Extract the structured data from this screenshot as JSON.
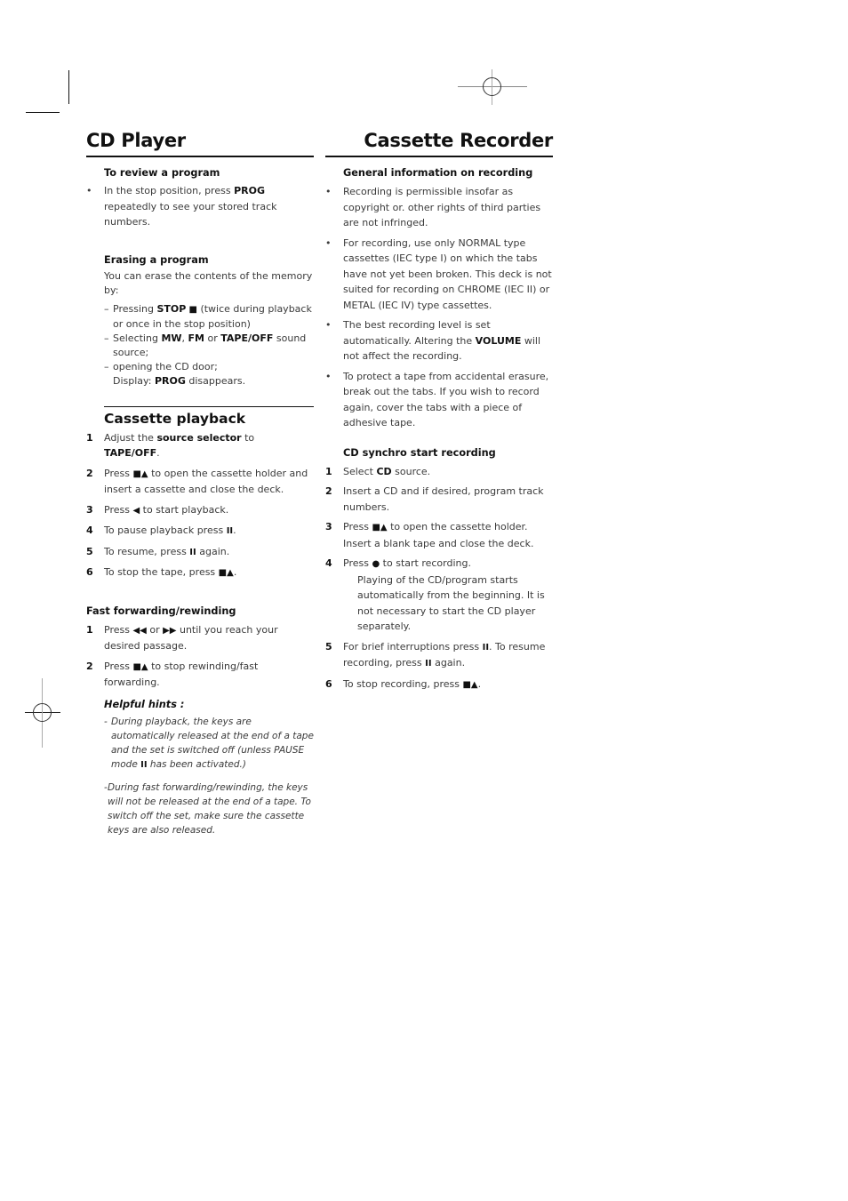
{
  "left": {
    "title": "CD Player",
    "review": {
      "heading": "To review a program",
      "bullet_mark": "•",
      "text_a": "In the stop position, press ",
      "text_b": "PROG",
      "text_c": " repeatedly to see your stored track numbers."
    },
    "erase": {
      "heading": "Erasing a program",
      "intro": "You can erase the contents of the memory by:",
      "dash_mark": "–",
      "items": [
        {
          "a": "Pressing ",
          "b": "STOP",
          "sym": " ■",
          "c": " (twice during playback or once in the stop position)"
        },
        {
          "a": "Selecting ",
          "b": "MW",
          "c": ", ",
          "d": "FM",
          "e": " or ",
          "f": "TAPE/OFF",
          "g": " sound source;"
        },
        {
          "a": "opening the CD door;",
          "b_pre": "Display: ",
          "b": "PROG",
          "c": " disappears."
        }
      ]
    },
    "playback": {
      "heading": "Cassette playback",
      "steps": [
        {
          "num": "1",
          "a": "Adjust the ",
          "b": "source selector",
          "c": " to ",
          "d": "TAPE/OFF",
          "e": "."
        },
        {
          "num": "2",
          "a": "Press ",
          "sym": "■▲",
          "c": " to open the cassette holder and insert a cassette and close the deck."
        },
        {
          "num": "3",
          "a": "Press ",
          "sym": "◀",
          "c": " to start playback."
        },
        {
          "num": "4",
          "a": "To pause playback press ",
          "sym": "II",
          "c": "."
        },
        {
          "num": "5",
          "a": "To resume, press ",
          "sym": "II",
          "c": " again."
        },
        {
          "num": "6",
          "a": "To stop the tape, press ",
          "sym": "■▲",
          "c": "."
        }
      ]
    },
    "ffwd": {
      "heading": "Fast forwarding/rewinding",
      "steps": [
        {
          "num": "1",
          "a": "Press ",
          "sym1": "◀◀",
          "b": " or ",
          "sym2": "▶▶",
          "c": " until you reach your desired passage."
        },
        {
          "num": "2",
          "a": "Press ",
          "sym": "■▲",
          "c": " to stop rewinding/fast forwarding."
        }
      ],
      "hints_heading": "Helpful hints :",
      "hints": [
        {
          "mark": "-",
          "a": "During playback, the keys are automatically released at the end of a tape and the set is switched off (unless PAUSE mode ",
          "sym": "II",
          "c": " has been activated.)"
        },
        {
          "mark": "-",
          "a": "During fast forwarding/rewinding, the keys will not be released at the end of a tape. To switch off the set, make sure the cassette keys are also released."
        }
      ]
    }
  },
  "right": {
    "title": "Cassette Recorder",
    "general": {
      "heading": "General information on recording",
      "bullets": [
        {
          "a": "Recording is permissible insofar as copyright or. other rights of third parties are not infringed."
        },
        {
          "a": "For recording, use only NORMAL type cassettes (IEC type I) on which the tabs have not yet been broken. This deck is not suited for recording on CHROME (IEC II) or METAL (IEC IV) type cassettes."
        },
        {
          "a": "The best recording level is set automatically. Altering the ",
          "b": "VOLUME",
          "c": " will not affect the recording."
        },
        {
          "a": "To protect a tape from accidental erasure, break out the tabs. If you wish to record again, cover the tabs with a piece of adhesive tape."
        }
      ]
    },
    "synchro": {
      "heading": "CD synchro start recording",
      "steps": [
        {
          "num": "1",
          "a": "Select ",
          "b": "CD",
          "c": " source."
        },
        {
          "num": "2",
          "a": "Insert a CD and if desired, program track numbers."
        },
        {
          "num": "3",
          "a": "Press ",
          "sym": "■▲",
          "c": " to open the cassette holder. Insert a blank tape and close the deck."
        },
        {
          "num": "4",
          "a": "Press ",
          "sym": "●",
          "c": " to start recording.",
          "sub": "Playing of the CD/program starts automatically from the beginning. It is not necessary to start the CD player separately."
        },
        {
          "num": "5",
          "a": "For brief interruptions press ",
          "sym": "II",
          "c": ". To resume recording, press ",
          "sym2": "II",
          "d": " again."
        },
        {
          "num": "6",
          "a": "To stop recording, press ",
          "sym": "■▲",
          "c": "."
        }
      ]
    }
  }
}
